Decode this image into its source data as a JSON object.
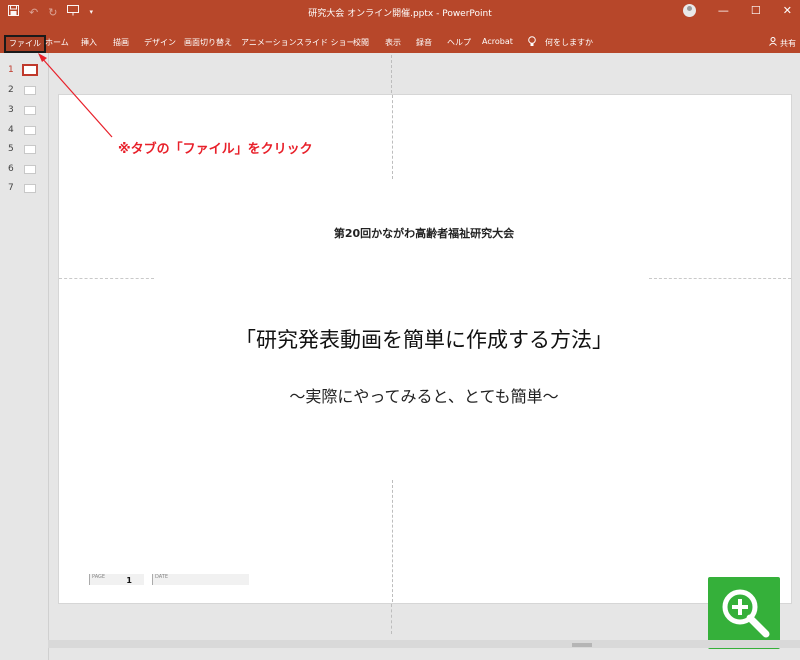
{
  "window": {
    "title": "研究大会 オンライン開催.pptx  -  PowerPoint"
  },
  "qat": {
    "save_icon": "save-icon",
    "undo_icon": "undo-icon",
    "redo_icon": "redo-icon",
    "start_icon": "start-from-beginning-icon",
    "more_icon": "customize-qat-icon"
  },
  "ribbon": {
    "tabs": [
      "ファイル",
      "ホーム",
      "挿入",
      "描画",
      "デザイン",
      "画面切り替え",
      "アニメーション",
      "スライド ショー",
      "校閲",
      "表示",
      "録音",
      "ヘルプ",
      "Acrobat"
    ],
    "tell_me": "何をしますか",
    "share": "共有"
  },
  "thumbnails": [
    "1",
    "2",
    "3",
    "4",
    "5",
    "6",
    "7"
  ],
  "slide": {
    "conference": "第20回かながわ高齢者福祉研究大会",
    "title": "「研究発表動画を簡単に作成する方法」",
    "subtitle": "〜実際にやってみると、とても簡単〜",
    "page_label": "PAGE",
    "page_value": "1",
    "date_label": "DATE"
  },
  "annotation": {
    "text": "※タブの「ファイル」をクリック"
  },
  "colors": {
    "accent": "#b7472a",
    "annotation": "#e8202a",
    "zoom_button": "#35b03a"
  }
}
